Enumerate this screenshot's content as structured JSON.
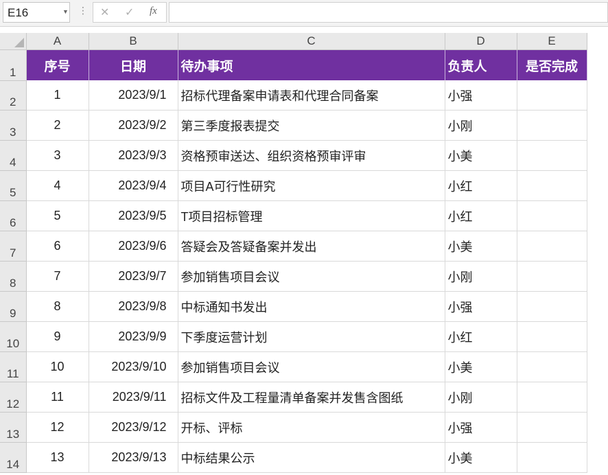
{
  "formula_bar": {
    "name_box": "E16",
    "cancel_icon": "✕",
    "enter_icon": "✓",
    "fx_label": "fx",
    "formula": ""
  },
  "columns": [
    "A",
    "B",
    "C",
    "D",
    "E"
  ],
  "row_numbers": [
    "1",
    "2",
    "3",
    "4",
    "5",
    "6",
    "7",
    "8",
    "9",
    "10",
    "11",
    "12",
    "13",
    "14"
  ],
  "header": [
    "序号",
    "日期",
    "待办事项",
    "负责人",
    "是否完成"
  ],
  "rows": [
    [
      "1",
      "2023/9/1",
      "招标代理备案申请表和代理合同备案",
      "小强",
      ""
    ],
    [
      "2",
      "2023/9/2",
      "第三季度报表提交",
      "小刚",
      ""
    ],
    [
      "3",
      "2023/9/3",
      "资格预审送达、组织资格预审评审",
      "小美",
      ""
    ],
    [
      "4",
      "2023/9/4",
      "项目A可行性研究",
      "小红",
      ""
    ],
    [
      "5",
      "2023/9/5",
      "T项目招标管理",
      "小红",
      ""
    ],
    [
      "6",
      "2023/9/6",
      "答疑会及答疑备案并发出",
      "小美",
      ""
    ],
    [
      "7",
      "2023/9/7",
      "参加销售项目会议",
      "小刚",
      ""
    ],
    [
      "8",
      "2023/9/8",
      "中标通知书发出",
      "小强",
      ""
    ],
    [
      "9",
      "2023/9/9",
      "下季度运营计划",
      "小红",
      ""
    ],
    [
      "10",
      "2023/9/10",
      "参加销售项目会议",
      "小美",
      ""
    ],
    [
      "11",
      "2023/9/11",
      "招标文件及工程量清单备案并发售含图纸",
      "小刚",
      ""
    ],
    [
      "12",
      "2023/9/12",
      "开标、评标",
      "小强",
      ""
    ],
    [
      "13",
      "2023/9/13",
      "中标结果公示",
      "小美",
      ""
    ]
  ],
  "colors": {
    "header_fill": "#7030a0",
    "header_text": "#ffffff"
  }
}
